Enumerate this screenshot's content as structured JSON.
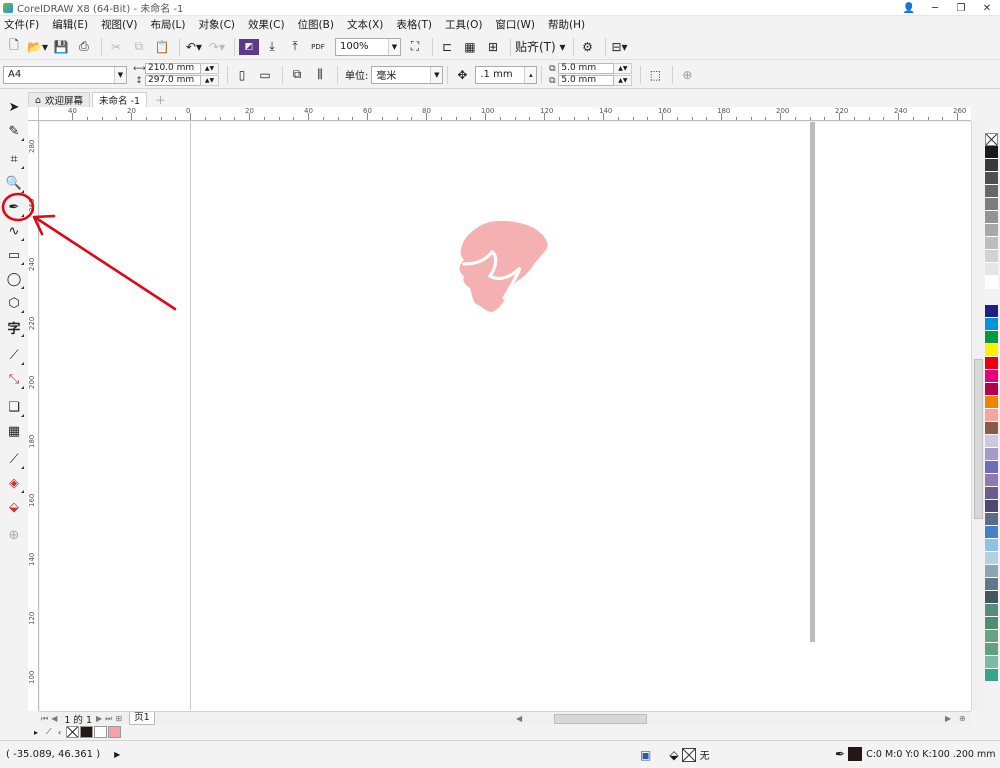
{
  "window": {
    "title": "CorelDRAW X8 (64-Bit) - 未命名 -1",
    "buttons": [
      "👤",
      "─",
      "❐",
      "✕"
    ]
  },
  "menu": [
    "文件(F)",
    "编辑(E)",
    "视图(V)",
    "布局(L)",
    "对象(C)",
    "效果(C)",
    "位图(B)",
    "文本(X)",
    "表格(T)",
    "工具(O)",
    "窗口(W)",
    "帮助(H)"
  ],
  "toolbar": {
    "zoom": "100%",
    "snap_label": "贴齐(T)",
    "pdf_label": "PDF"
  },
  "property_bar": {
    "page_size": "A4",
    "width": "210.0 mm",
    "height": "297.0 mm",
    "unit_label": "单位:",
    "unit_value": "毫米",
    "nudge": ".1 mm",
    "dup_x": "5.0 mm",
    "dup_y": "5.0 mm"
  },
  "tabs": [
    {
      "label": "欢迎屏幕",
      "icon": "home-icon"
    },
    {
      "label": "未命名 -1",
      "active": true
    }
  ],
  "tools": [
    {
      "name": "pick-tool",
      "glyph": "➤"
    },
    {
      "name": "shape-tool",
      "glyph": "✎"
    },
    {
      "name": "crop-tool",
      "glyph": "⌗"
    },
    {
      "name": "zoom-tool",
      "glyph": "🔍"
    },
    {
      "name": "pen-tool",
      "glyph": "✒"
    },
    {
      "name": "artistic-media-tool",
      "glyph": "∿"
    },
    {
      "name": "rectangle-tool",
      "glyph": "▭"
    },
    {
      "name": "ellipse-tool",
      "glyph": "◯"
    },
    {
      "name": "polygon-tool",
      "glyph": "⬡"
    },
    {
      "name": "text-tool",
      "glyph": "字"
    },
    {
      "name": "parallel-dimension-tool",
      "glyph": "⟋"
    },
    {
      "name": "connector-tool",
      "glyph": "⤡"
    },
    {
      "name": "drop-shadow-tool",
      "glyph": "❏"
    },
    {
      "name": "transparency-tool",
      "glyph": "▦"
    },
    {
      "name": "eyedropper-tool",
      "glyph": "⟋"
    },
    {
      "name": "interactive-fill-tool",
      "glyph": "◈"
    },
    {
      "name": "smart-fill-tool",
      "glyph": "⬙"
    },
    {
      "name": "add-tool",
      "glyph": "⊕"
    }
  ],
  "ruler": {
    "h_labels": [
      "40",
      "20",
      "0",
      "20",
      "40",
      "60",
      "80",
      "100",
      "120",
      "140",
      "160",
      "180",
      "200",
      "220",
      "240",
      "260"
    ],
    "v_labels": [
      "280",
      "260",
      "240",
      "220",
      "200",
      "180",
      "160",
      "140",
      "120",
      "100"
    ],
    "unit": "毫米"
  },
  "palette": [
    "#1a1a1a",
    "#3a3a3a",
    "#505050",
    "#686868",
    "#7d7d7d",
    "#939393",
    "#a8a8a8",
    "#bdbdbd",
    "#d2d2d2",
    "#e6e6e6",
    "#ffffff",
    "#1d2088",
    "#0095d9",
    "#009944",
    "#fff100",
    "#e60012",
    "#e4007f",
    "#b5004f",
    "#f08300",
    "#f5a3a3",
    "#8a5a44",
    "#cfc6e0",
    "#a59aca",
    "#6f6db6",
    "#8e7bb5",
    "#6a5c8d",
    "#4e4970",
    "#5c6b8a",
    "#4582c4",
    "#8fc3e6",
    "#b4cfe0",
    "#8aa5b5",
    "#62788a",
    "#43565f",
    "#5a8a7d",
    "#4f8c72",
    "#6aa088",
    "#5fa37a",
    "#7bbb9f",
    "#3aa38b"
  ],
  "page_nav": {
    "counter": "1 的 1",
    "page_tab": "页1"
  },
  "document_colors": [
    "#ffffff",
    "#231815",
    "#ffffff",
    "#f5a3a3"
  ],
  "status": {
    "coords": "( -35.089, 46.361 )",
    "fill_label": "无",
    "outline_text": "C:0 M:0 Y:0 K:100  .200 mm"
  },
  "shape_color": "#f5b1b1",
  "accent": "#e30613"
}
